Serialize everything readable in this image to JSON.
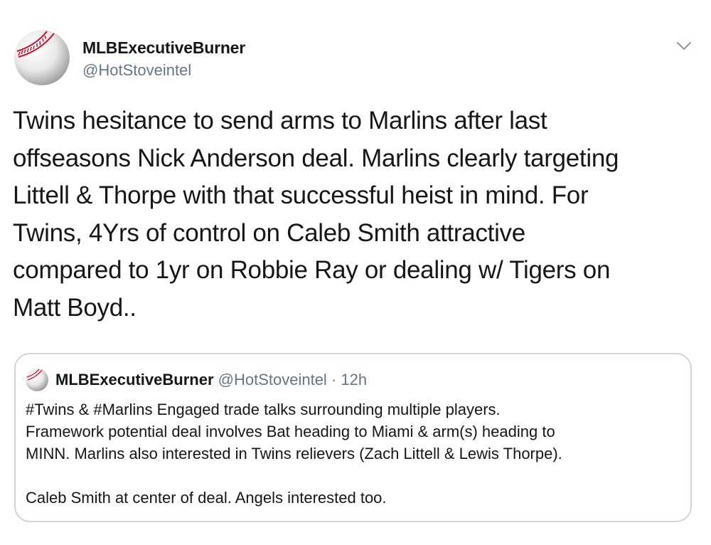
{
  "author": {
    "display_name": "MLBExecutiveBurner",
    "handle": "@HotStoveintel",
    "avatar_icon": "baseball-icon"
  },
  "menu_icon": "chevron-down-icon",
  "tweet_text_lines": [
    "Twins hesitance to send arms to Marlins after last",
    "offseasons Nick Anderson deal. Marlins clearly targeting",
    "Littell & Thorpe with that successful heist in mind. For",
    "Twins, 4Yrs of control on Caleb Smith attractive",
    "compared to 1yr on Robbie Ray or dealing w/ Tigers on",
    "Matt Boyd.."
  ],
  "quoted_tweet": {
    "display_name": "MLBExecutiveBurner",
    "handle": "@HotStoveintel",
    "separator": "·",
    "timestamp": "12h",
    "paragraph1_lines": [
      "#Twins & #Marlins Engaged trade talks surrounding multiple players.",
      "Framework potential deal involves Bat heading to Miami & arm(s) heading to",
      "MINN. Marlins also interested in Twins relievers (Zach Littell & Lewis Thorpe)."
    ],
    "paragraph2": "Caleb Smith at center of deal. Angels interested too."
  },
  "colors": {
    "text_primary": "#14171a",
    "text_secondary": "#657786",
    "border": "#ccd6dd",
    "baseball_stitch": "#c8102e"
  }
}
